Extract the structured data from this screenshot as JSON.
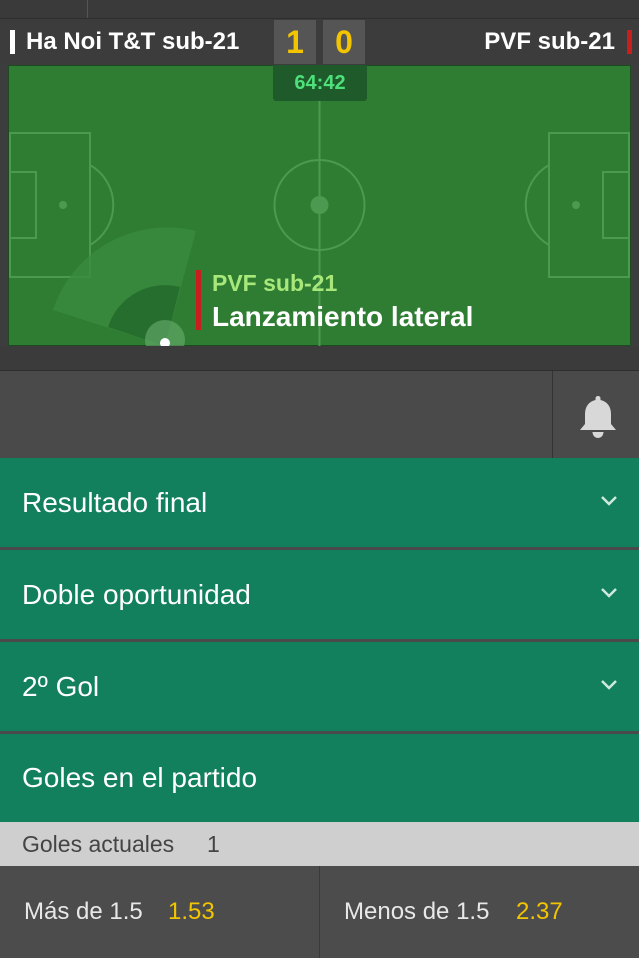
{
  "match": {
    "home_team": "Ha Noi T&T sub-21",
    "away_team": "PVF sub-21",
    "home_score": "1",
    "away_score": "0",
    "timer": "64:42"
  },
  "event": {
    "team": "PVF sub-21",
    "description": "Lanzamiento lateral"
  },
  "markets": [
    {
      "label": "Resultado final",
      "expandable": true
    },
    {
      "label": "Doble oportunidad",
      "expandable": true
    },
    {
      "label": "2º Gol",
      "expandable": true
    },
    {
      "label": "Goles en el partido",
      "expandable": false
    }
  ],
  "goals": {
    "label": "Goles actuales",
    "value": "1"
  },
  "odds": [
    {
      "name": "Más de 1.5",
      "price": "1.53"
    },
    {
      "name": "Menos de 1.5",
      "price": "2.37"
    }
  ],
  "colors": {
    "score": "#f2c500",
    "market_bg": "#12805c",
    "pitch": "#2e7d32",
    "event_accent": "#c81e1e",
    "event_team": "#a8e87a",
    "timer_text": "#4ee07a"
  },
  "icons": {
    "notifications": "bell-icon",
    "expand": "chevron-down-icon"
  }
}
